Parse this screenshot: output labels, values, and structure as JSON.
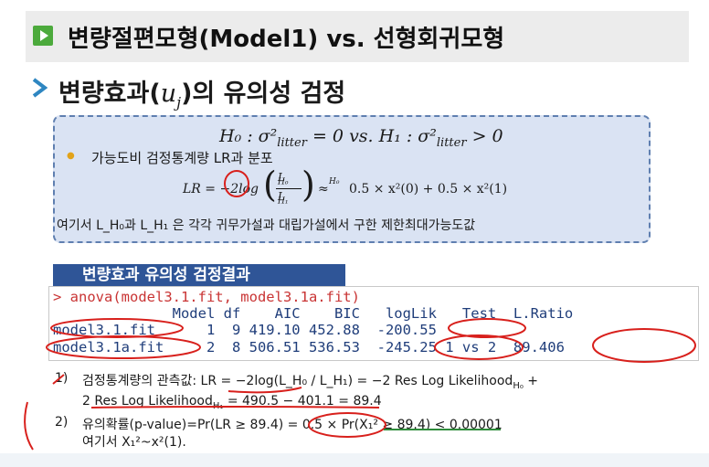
{
  "title": "변량절편모형(Model1) vs. 선형회귀모형",
  "subheading": {
    "prefix": "변량효과(",
    "math": "u",
    "sub": "j",
    "suffix": ")의 유의성 검정"
  },
  "hypothesis": {
    "h0": "H₀ : σ²",
    "h0_sub": "litter",
    "h0_rest": " = 0  vs. H₁ : σ²",
    "h1_sub": "litter",
    "h1_rest": " > 0"
  },
  "lr_title": "가능도비 검정통계량 LR과 분포",
  "lr_formula": {
    "lhs": "LR = −2log",
    "num": "L",
    "num_sub": "H₀",
    "den": "L",
    "den_sub": "H₁",
    "approx": "≈",
    "approx_sup": "H₀",
    "rhs": "0.5 × x²(0) + 0.5 × x²(1)"
  },
  "lr_note": "여기서 L_H₀과 L_H₁ 은 각각 귀무가설과 대립가설에서 구한 제한최대가능도값",
  "results": {
    "header": "변량효과 유의성 검정결과",
    "command": "> anova(model3.1.fit, model3.1a.fit)",
    "columns": "              Model df    AIC    BIC   logLik   Test  L.Ratio",
    "row1": "model3.1.fit      1  9 419.10 452.88  -200.55",
    "row2": "model3.1a.fit     2  8 506.51 536.53  -245.25 1 vs 2  89.406"
  },
  "notes": {
    "n1_label": "1)",
    "n1_text": "검정통계량의 관측값: LR = −2log(L_H₀ / L_H₁) = −2 Res Log Likelihood",
    "n1_sub": "H₀",
    "n1_end": " +",
    "n1b_text": "2 Res Log Likelihood",
    "n1b_sub": "H₁",
    "n1b_end": " = 490.5 − 401.1 = 89.4",
    "n2_label": "2)",
    "n2_text": "유의확률(p-value)=Pr(LR ≥ 89.4) = 0.5 × Pr(X₁² ≥ 89.4) < 0.00001",
    "n2b_text": "여기서 X₁²~x²(1)."
  },
  "colors": {
    "accent_green": "#4caa3c",
    "box_fill": "#dae3f3",
    "header_blue": "#2f5597",
    "annotation_red": "#d8201c"
  }
}
